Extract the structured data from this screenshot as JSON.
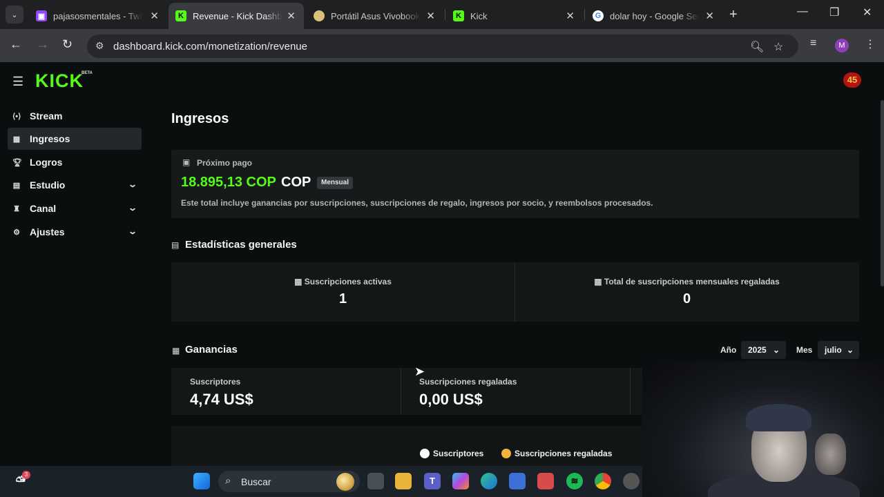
{
  "browser": {
    "tabs": [
      {
        "title": "pajasosmentales - Twitch",
        "active": false
      },
      {
        "title": "Revenue - Kick Dashboard",
        "active": true
      },
      {
        "title": "Portátil Asus Vivobook",
        "active": false
      },
      {
        "title": "Kick",
        "active": false
      },
      {
        "title": "dolar hoy - Google Search",
        "active": false
      }
    ],
    "url": "dashboard.kick.com/monetization/revenue",
    "profile_initial": "M"
  },
  "header": {
    "logo": "KICK",
    "logo_badge": "BETA",
    "notification_count": "45"
  },
  "sidebar": {
    "items": [
      {
        "label": "Stream",
        "icon": "broadcast-icon",
        "active": false,
        "expandable": false
      },
      {
        "label": "Ingresos",
        "icon": "chart-icon",
        "active": true,
        "expandable": false
      },
      {
        "label": "Logros",
        "icon": "trophy-icon",
        "active": false,
        "expandable": false
      },
      {
        "label": "Estudio",
        "icon": "studio-icon",
        "active": false,
        "expandable": true
      },
      {
        "label": "Canal",
        "icon": "channel-icon",
        "active": false,
        "expandable": true
      },
      {
        "label": "Ajustes",
        "icon": "gear-icon",
        "active": false,
        "expandable": true
      }
    ]
  },
  "main": {
    "title": "Ingresos",
    "payout": {
      "label": "Próximo pago",
      "amount": "18.895,13 COP",
      "currency": "COP",
      "badge": "Mensual",
      "note": "Este total incluye ganancias por suscripciones, suscripciones de regalo, ingresos por socio, y reembolsos procesados."
    },
    "general_stats": {
      "title": "Estadísticas generales",
      "active_subs_label": "Suscripciones activas",
      "active_subs_value": "1",
      "gifted_label": "Total de suscripciones mensuales regaladas",
      "gifted_value": "0"
    },
    "earnings": {
      "title": "Ganancias",
      "year_label": "Año",
      "year_value": "2025",
      "month_label": "Mes",
      "month_value": "julio",
      "subs_label": "Suscriptores",
      "subs_value": "4,74 US$",
      "gifted_label": "Suscripciones regaladas",
      "gifted_value": "0,00 US$",
      "legend": [
        {
          "name": "Suscriptores",
          "color": "#ffffff"
        },
        {
          "name": "Suscripciones regaladas",
          "color": "#f3b33d"
        }
      ]
    }
  },
  "taskbar": {
    "search_placeholder": "Buscar",
    "weather_badge": "3"
  },
  "colors": {
    "accent": "#53fc18",
    "background": "#0b0e0f",
    "card": "#171a1b"
  }
}
